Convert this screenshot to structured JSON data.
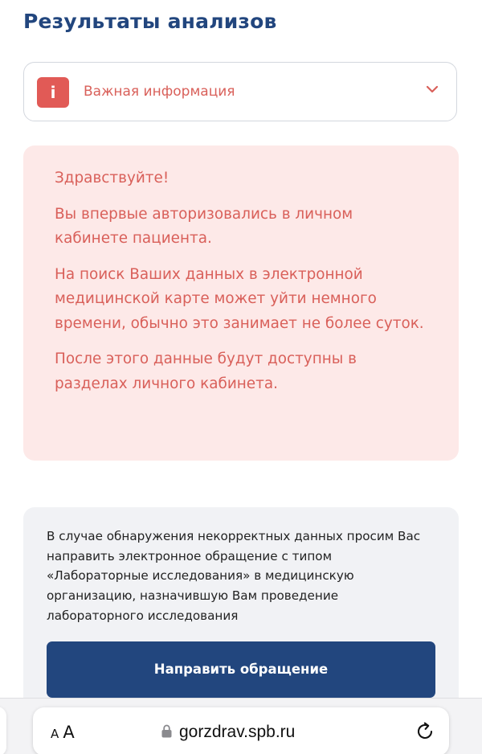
{
  "page": {
    "title": "Результаты анализов"
  },
  "important_info": {
    "badge": "i",
    "label": "Важная информация",
    "chevron_icon": "chevron-down-icon"
  },
  "alert": {
    "paragraphs": [
      "Здравствуйте!",
      "Вы впервые авторизовались в личном кабинете пациента.",
      "На поиск Ваших данных в электронной медицинской карте может уйти немного времени, обычно это занимает не более суток.",
      "После этого данные будут доступны в разделах личного кабинета."
    ]
  },
  "notice": {
    "text": "В случае обнаружения некорректных данных просим Вас направить электронное обращение с типом «Лабораторные исследования» в медицинскую организацию, назначившую Вам проведение лабораторного исследования",
    "button_label": "Направить обращение"
  },
  "browser": {
    "text_size_label": "AA",
    "lock_icon": "lock-icon",
    "url": "gorzdrav.spb.ru",
    "reload_icon": "reload-icon"
  },
  "colors": {
    "brand_blue": "#22467e",
    "alert_red": "#d9605a",
    "badge_red": "#e15a56",
    "alert_bg": "#fde9e8",
    "card_bg": "#f1f2f5"
  }
}
